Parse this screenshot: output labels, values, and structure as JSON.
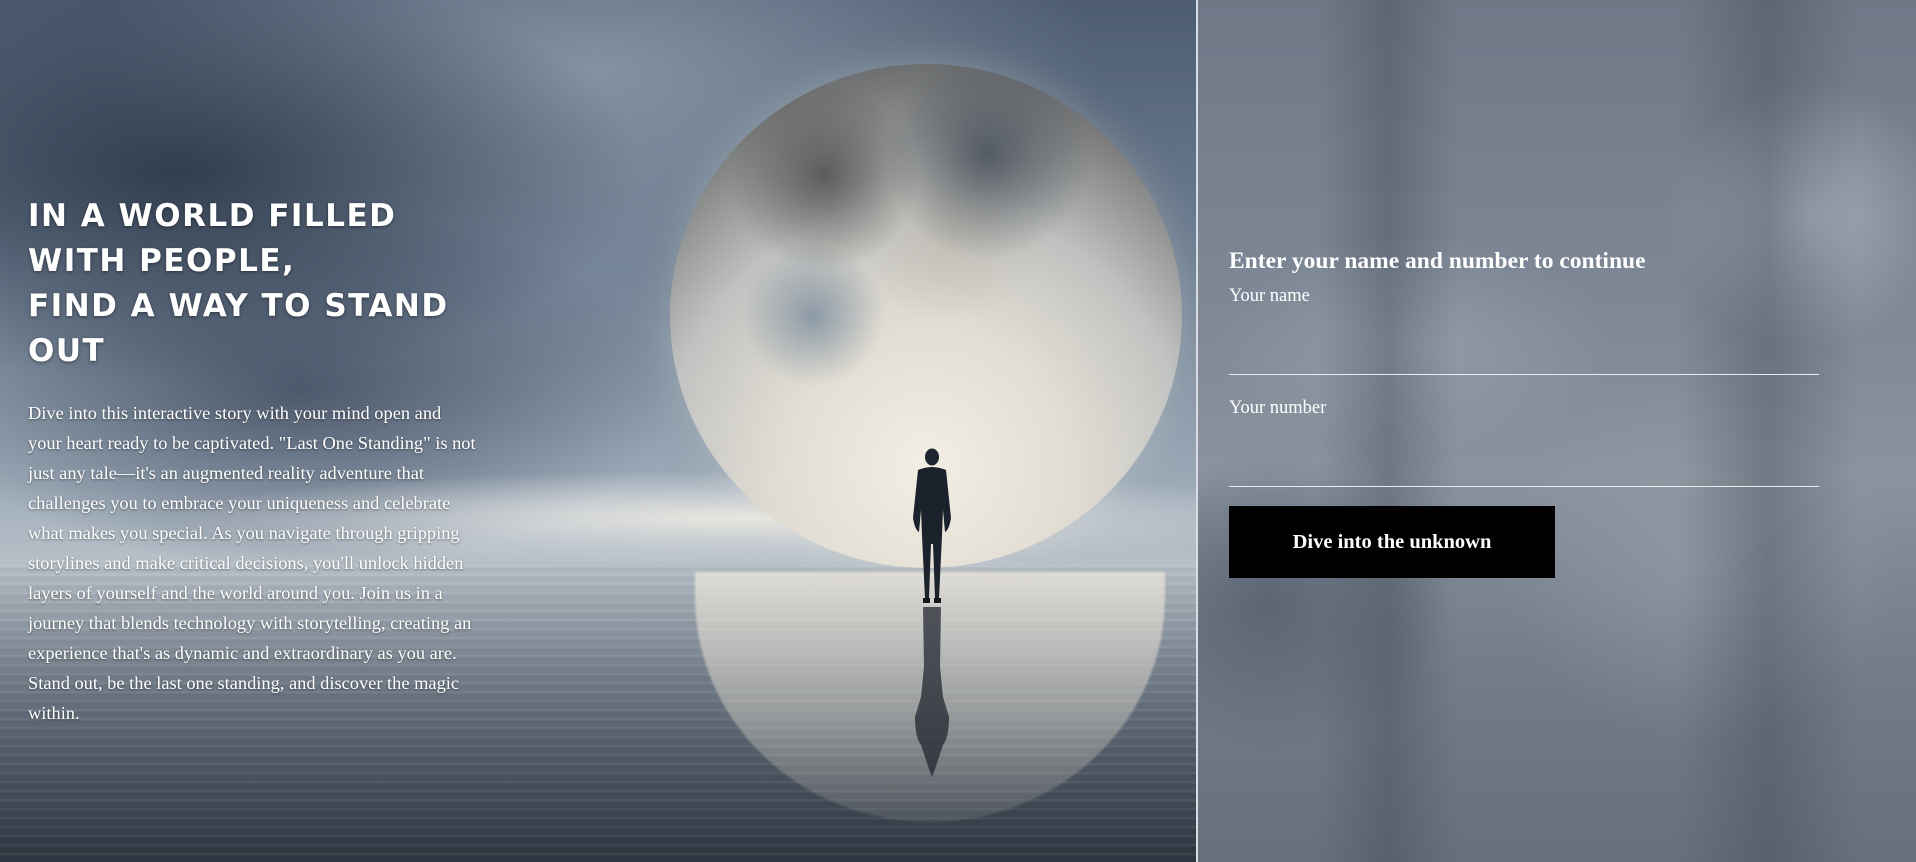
{
  "hero": {
    "title_line1": "In a world filled with people,",
    "title_line2": "find a way to stand out",
    "body": "Dive into this interactive story with your mind open and your heart ready to be captivated. \"Last One Standing\" is not just any tale—it's an augmented reality adventure that challenges you to embrace your uniqueness and celebrate what makes you special. As you navigate through gripping storylines and make critical decisions, you'll unlock hidden layers of yourself and the world around you. Join us in a journey that blends technology with storytelling, creating an experience that's as dynamic and extraordinary as you are. Stand out, be the last one standing, and discover the magic within.",
    "image": "moon-silhouette-illustration"
  },
  "form": {
    "heading": "Enter your name and number to continue",
    "name_label": "Your name",
    "name_value": "",
    "number_label": "Your number",
    "number_value": "",
    "submit_label": "Dive into the unknown"
  },
  "colors": {
    "button_bg": "#000000",
    "button_text": "#ffffff",
    "text": "#ffffff",
    "divider": "#d8dde3"
  }
}
